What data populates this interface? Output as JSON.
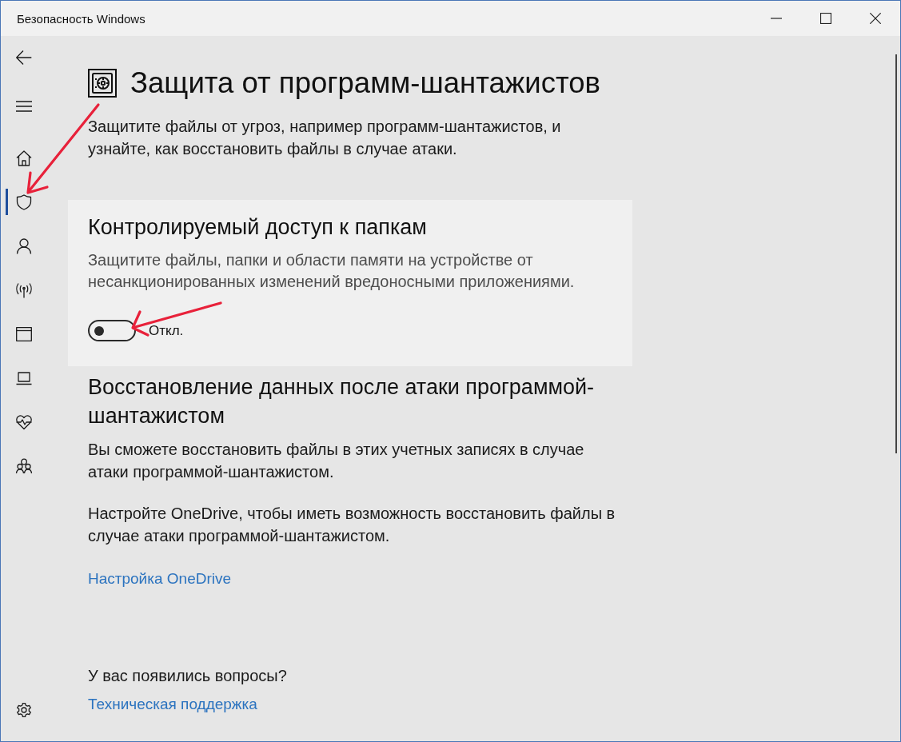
{
  "window": {
    "title": "Безопасность Windows",
    "controls": [
      {
        "kind": "minimize"
      },
      {
        "kind": "maximize"
      },
      {
        "kind": "close"
      }
    ]
  },
  "sidebar": {
    "top_buttons": [
      {
        "kind": "back"
      },
      {
        "kind": "menu"
      }
    ],
    "items": [
      {
        "kind": "home",
        "selected": false
      },
      {
        "kind": "shield",
        "selected": true
      },
      {
        "kind": "account",
        "selected": false
      },
      {
        "kind": "network",
        "selected": false
      },
      {
        "kind": "app_browser",
        "selected": false
      },
      {
        "kind": "device",
        "selected": false
      },
      {
        "kind": "health",
        "selected": false
      },
      {
        "kind": "family",
        "selected": false
      }
    ],
    "bottom_buttons": [
      {
        "kind": "settings"
      }
    ]
  },
  "page": {
    "title": "Защита от программ-шантажистов",
    "description": "Защитите файлы от угроз, например программ-шантажистов, и узнайте, как восстановить файлы в случае атаки."
  },
  "controlled_folder_access": {
    "title": "Контролируемый доступ к папкам",
    "description": "Защитите файлы, папки и области памяти на устройстве от несанкционированных изменений вредоносными приложениями.",
    "toggle": {
      "on": false,
      "label": "Откл."
    }
  },
  "recovery": {
    "title": "Восстановление данных после атаки программой-шантажистом",
    "paragraphs": [
      "Вы сможете восстановить файлы в этих учетных записях в случае атаки программой-шантажистом.",
      "Настройте OneDrive, чтобы иметь возможность восстановить файлы в случае атаки программой-шантажистом."
    ],
    "link": "Настройка OneDrive"
  },
  "help": {
    "question": "У вас появились вопросы?",
    "link": "Техническая поддержка"
  },
  "annotations": [
    {
      "kind": "arrow"
    },
    {
      "kind": "arrow"
    }
  ]
}
